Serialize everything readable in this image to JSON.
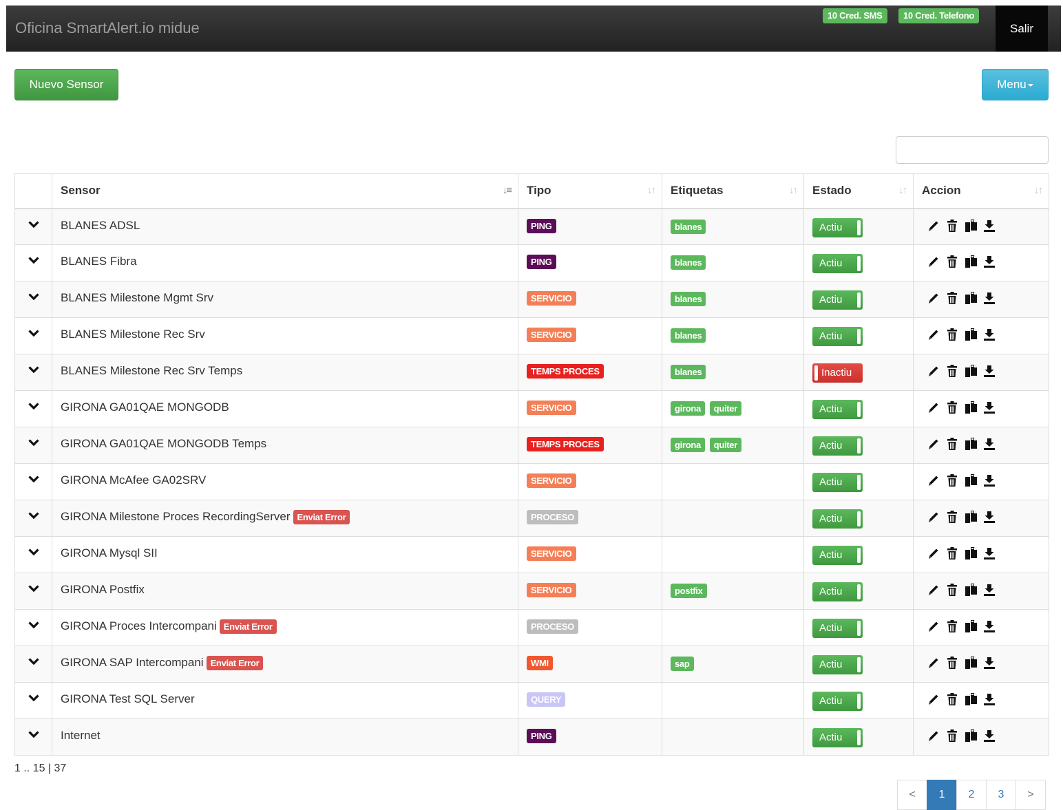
{
  "navbar": {
    "brand": "Oficina SmartAlert.io midue",
    "credits_sms": "10 Cred. SMS",
    "credits_phone": "10 Cred. Telefono",
    "logout": "Salir"
  },
  "toolbar": {
    "new_sensor": "Nuevo Sensor",
    "menu": "Menu"
  },
  "search": {
    "value": "",
    "placeholder": ""
  },
  "table": {
    "columns": [
      "",
      "Sensor",
      "Tipo",
      "Etiquetas",
      "Estado",
      "Accion"
    ],
    "sorted_column": "Sensor",
    "rows": [
      {
        "sensor": "BLANES ADSL",
        "error": "",
        "tipo": "PING",
        "tags": [
          "blanes"
        ],
        "estado": "Actiu"
      },
      {
        "sensor": "BLANES Fibra",
        "error": "",
        "tipo": "PING",
        "tags": [
          "blanes"
        ],
        "estado": "Actiu"
      },
      {
        "sensor": "BLANES Milestone Mgmt Srv",
        "error": "",
        "tipo": "SERVICIO",
        "tags": [
          "blanes"
        ],
        "estado": "Actiu"
      },
      {
        "sensor": "BLANES Milestone Rec Srv",
        "error": "",
        "tipo": "SERVICIO",
        "tags": [
          "blanes"
        ],
        "estado": "Actiu"
      },
      {
        "sensor": "BLANES Milestone Rec Srv Temps",
        "error": "",
        "tipo": "TEMPS PROCES",
        "tags": [
          "blanes"
        ],
        "estado": "Inactiu"
      },
      {
        "sensor": "GIRONA GA01QAE MONGODB",
        "error": "",
        "tipo": "SERVICIO",
        "tags": [
          "girona",
          "quiter"
        ],
        "estado": "Actiu"
      },
      {
        "sensor": "GIRONA GA01QAE MONGODB Temps",
        "error": "",
        "tipo": "TEMPS PROCES",
        "tags": [
          "girona",
          "quiter"
        ],
        "estado": "Actiu"
      },
      {
        "sensor": "GIRONA McAfee GA02SRV",
        "error": "",
        "tipo": "SERVICIO",
        "tags": [],
        "estado": "Actiu"
      },
      {
        "sensor": "GIRONA Milestone Proces RecordingServer",
        "error": "Enviat Error",
        "tipo": "PROCESO",
        "tags": [],
        "estado": "Actiu"
      },
      {
        "sensor": "GIRONA Mysql SII",
        "error": "",
        "tipo": "SERVICIO",
        "tags": [],
        "estado": "Actiu"
      },
      {
        "sensor": "GIRONA Postfix",
        "error": "",
        "tipo": "SERVICIO",
        "tags": [
          "postfix"
        ],
        "estado": "Actiu"
      },
      {
        "sensor": "GIRONA Proces Intercompani",
        "error": "Enviat Error",
        "tipo": "PROCESO",
        "tags": [],
        "estado": "Actiu"
      },
      {
        "sensor": "GIRONA SAP Intercompani",
        "error": "Enviat Error",
        "tipo": "WMI",
        "tags": [
          "sap"
        ],
        "estado": "Actiu"
      },
      {
        "sensor": "GIRONA Test SQL Server",
        "error": "",
        "tipo": "QUERY",
        "tags": [],
        "estado": "Actiu"
      },
      {
        "sensor": "Internet",
        "error": "",
        "tipo": "PING",
        "tags": [],
        "estado": "Actiu"
      }
    ],
    "row_actions": [
      "edit-icon",
      "trash-icon",
      "copy-icon",
      "export-icon"
    ]
  },
  "type_colors": {
    "PING": "#5b0d57",
    "SERVICIO": "#f47f57",
    "TEMPS PROCES": "#e8201e",
    "PROCESO": "#bdbdbd",
    "WMI": "#f0582f",
    "QUERY": "#c9c5f5"
  },
  "footer": {
    "page_info": "1 .. 15 | 37",
    "pagination": {
      "prev": "<",
      "pages": [
        "1",
        "2",
        "3"
      ],
      "current": "1",
      "next": ">"
    }
  }
}
